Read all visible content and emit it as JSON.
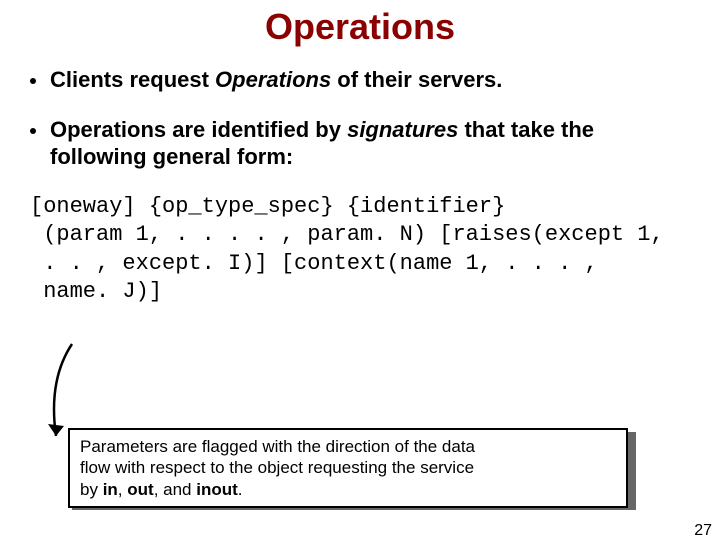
{
  "title": "Operations",
  "bullets": {
    "b1_pre": "Clients request ",
    "b1_em": "Operations",
    "b1_post": " of their servers.",
    "b2_pre": "Operations are identified by ",
    "b2_em": "signatures",
    "b2_post": " that take the following general form:"
  },
  "signature": "[oneway] {op_type_spec} {identifier}\n (param 1, . . . . , param. N) [raises(except 1,\n . . , except. I)] [context(name 1, . . . ,\n name. J)]",
  "callout": {
    "line1": "Parameters are flagged with the direction of the data",
    "line2": "flow with respect to the object requesting the service",
    "line3_pre": "by ",
    "kw1": "in",
    "sep1": ", ",
    "kw2": "out",
    "sep2": ", and ",
    "kw3": "inout",
    "line3_post": "."
  },
  "page": "27"
}
